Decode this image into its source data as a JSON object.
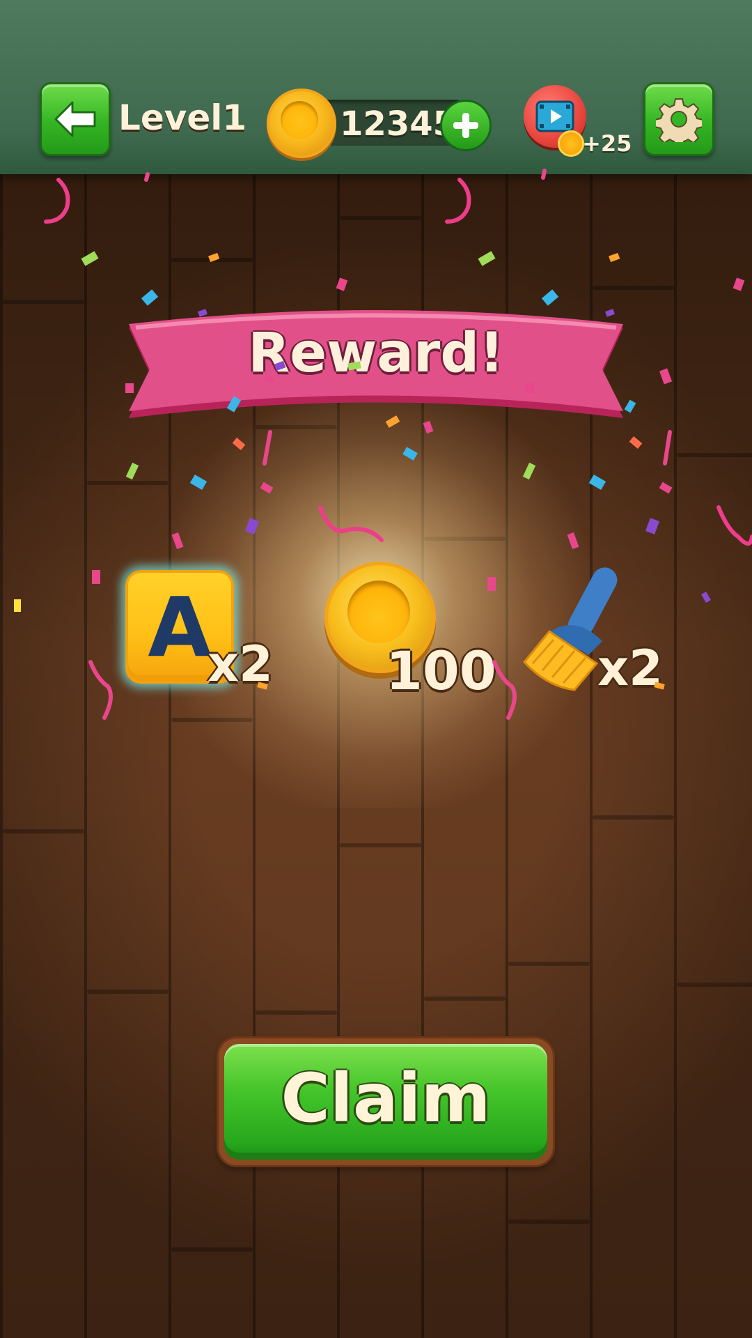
{
  "header": {
    "level_label": "Level1",
    "coin_count": "12345",
    "video_bonus": "+25"
  },
  "banner": {
    "title": "Reward!"
  },
  "rewards": [
    {
      "icon": "letter-hint-icon",
      "letter": "A",
      "quantity": "x2"
    },
    {
      "icon": "coin-icon",
      "quantity": "100"
    },
    {
      "icon": "brush-icon",
      "quantity": "x2"
    }
  ],
  "claim": {
    "label": "Claim"
  },
  "colors": {
    "top_bar": "#3f6a4f",
    "green_button": "#34b523",
    "ribbon": "#d8437a",
    "coin": "#f8b81c",
    "wood": "#5a341c"
  }
}
